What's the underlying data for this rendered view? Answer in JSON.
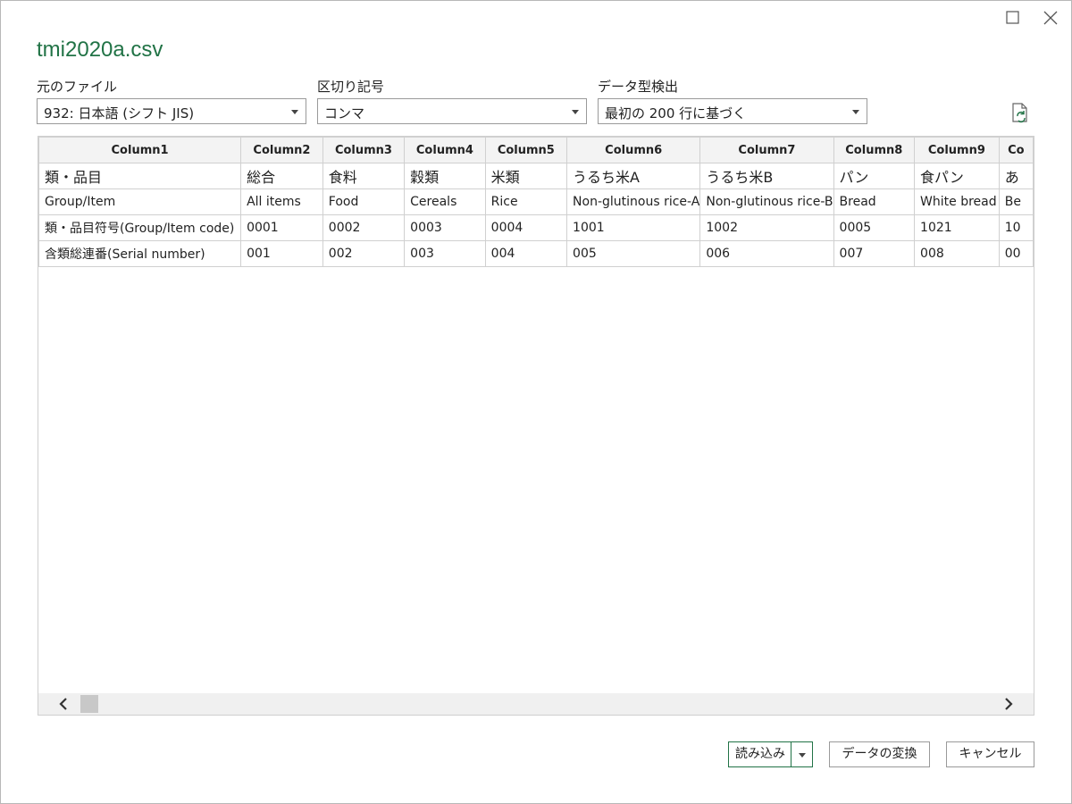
{
  "dialog": {
    "title": "tmi2020a.csv"
  },
  "fields": {
    "file_origin": {
      "label": "元のファイル",
      "value": "932: 日本語 (シフト JIS)"
    },
    "delimiter": {
      "label": "区切り記号",
      "value": "コンマ"
    },
    "type_detection": {
      "label": "データ型検出",
      "value": "最初の 200 行に基づく"
    }
  },
  "table": {
    "headers": [
      "Column1",
      "Column2",
      "Column3",
      "Column4",
      "Column5",
      "Column6",
      "Column7",
      "Column8",
      "Column9",
      "Co"
    ],
    "rows": [
      [
        "類・品目",
        "総合",
        "食料",
        "穀類",
        "米類",
        "うるち米A",
        "うるち米B",
        "パン",
        "食パン",
        "あ"
      ],
      [
        "Group/Item",
        "All items",
        "Food",
        "Cereals",
        "Rice",
        "Non-glutinous rice-A",
        "Non-glutinous rice-B",
        "Bread",
        "White bread",
        "Be"
      ],
      [
        "類・品目符号(Group/Item code)",
        "0001",
        "0002",
        "0003",
        "0004",
        "1001",
        "1002",
        "0005",
        "1021",
        "10"
      ],
      [
        "含類総連番(Serial number)",
        "001",
        "002",
        "003",
        "004",
        "005",
        "006",
        "007",
        "008",
        "00"
      ]
    ]
  },
  "buttons": {
    "load": "読み込み",
    "transform": "データの変換",
    "cancel": "キャンセル"
  },
  "colors": {
    "accent": "#217346"
  },
  "icons": {
    "maximize": "maximize-icon",
    "close": "close-icon",
    "refresh": "refresh-icon"
  }
}
